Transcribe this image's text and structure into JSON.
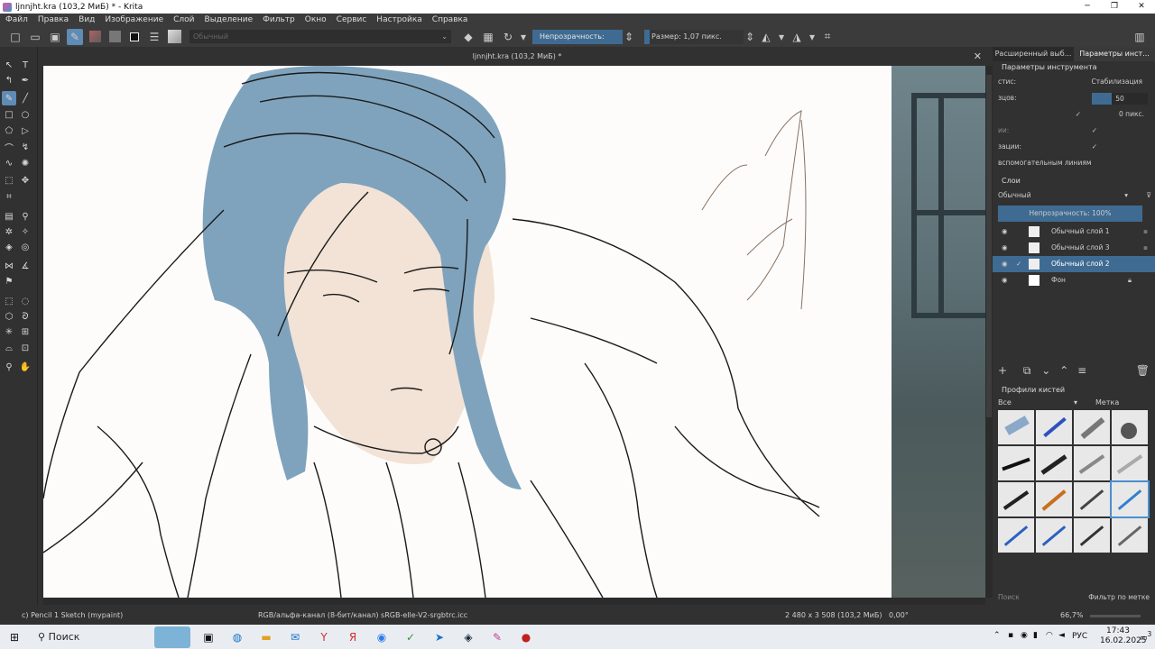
{
  "window": {
    "title": "ljnnjht.kra (103,2 МиБ) * - Krita",
    "minimize": "─",
    "maximize": "❐",
    "close": "✕"
  },
  "menu": [
    "Файл",
    "Правка",
    "Вид",
    "Изображение",
    "Слой",
    "Выделение",
    "Фильтр",
    "Окно",
    "Сервис",
    "Настройка",
    "Справка"
  ],
  "toolbar": {
    "preset_placeholder": "Обычный",
    "opacity_label": "Непрозрачность: 100%",
    "size_label": "Размер: 1,07 пикс."
  },
  "document": {
    "tab_title": "ljnnjht.kra (103,2 МиБ) *",
    "close": "✕"
  },
  "dock": {
    "tabs": [
      "Расширенный выб...",
      "Параметры инст..."
    ],
    "tool_options": {
      "title": "Параметры инструмента",
      "rows": [
        {
          "label": "стис:",
          "value": "Стабилизация"
        },
        {
          "label": "зцов:",
          "value": "50"
        },
        {
          "label": "",
          "value": "0 пикс."
        },
        {
          "label": "ии:",
          "value": ""
        },
        {
          "label": "зации:",
          "value": ""
        },
        {
          "label": "вспомогательным линиям",
          "value": ""
        }
      ]
    },
    "layers": {
      "title": "Слои",
      "blend_mode": "Обычный",
      "opacity": "Непрозрачность:  100%",
      "items": [
        {
          "name": "Обычный слой 1"
        },
        {
          "name": "Обычный слой 3"
        },
        {
          "name": "Обычный слой 2"
        },
        {
          "name": "Фон"
        }
      ]
    },
    "brushes": {
      "title": "Профили кистей",
      "filter": "Все",
      "tag": "Метка",
      "search_placeholder": "Поиск",
      "filter_by_tag": "Фильтр по метке"
    }
  },
  "status": {
    "brush": "c) Pencil 1 Sketch (mypaint)",
    "color": "RGB/альфа-канал (8-бит/канал)  sRGB-elle-V2-srgbtrc.icc",
    "dimensions": "2 480 x 3 508 (103,2 МиБ)",
    "rotation": "0,00°",
    "zoom": "66,7%"
  },
  "taskbar": {
    "search": "Поиск",
    "lang": "РУС",
    "time": "17:43",
    "date": "16.02.2025",
    "notif": "3"
  }
}
